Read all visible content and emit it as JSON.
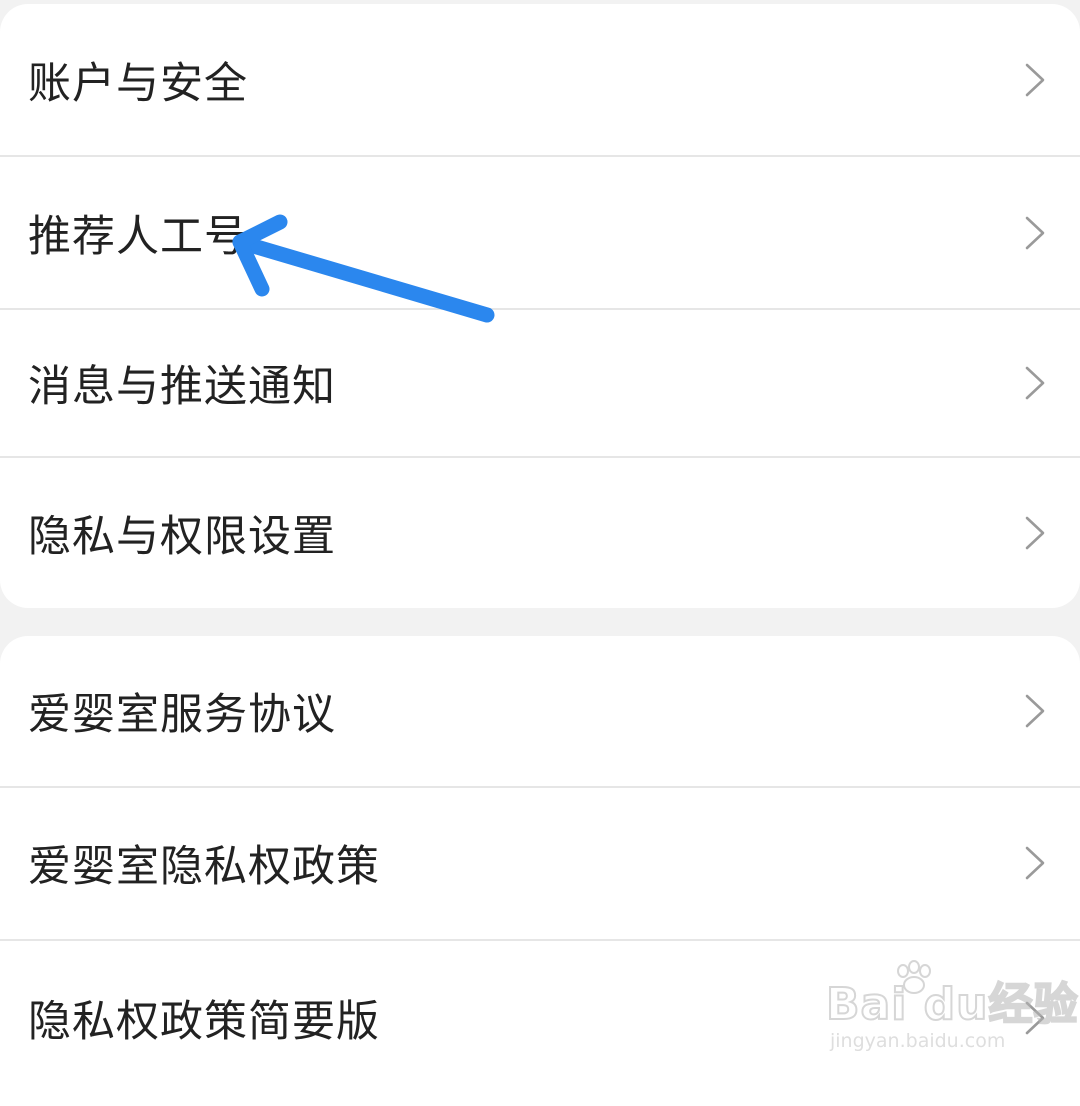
{
  "group1": {
    "items": [
      {
        "label": "账户与安全"
      },
      {
        "label": "推荐人工号"
      },
      {
        "label": "消息与推送通知"
      },
      {
        "label": "隐私与权限设置"
      }
    ]
  },
  "group2": {
    "items": [
      {
        "label": "爱婴室服务协议"
      },
      {
        "label": "爱婴室隐私权政策"
      },
      {
        "label": "隐私权政策简要版"
      }
    ]
  },
  "icons": {
    "row_chevron": "chevron-right-icon",
    "annotation": "arrow-annotation",
    "watermark_paw": "paw-icon"
  },
  "colors": {
    "annotation_arrow": "#2b87ee",
    "chevron": "#9a9a9a",
    "text": "#222222",
    "background": "#f2f2f2",
    "card": "#ffffff"
  },
  "watermark": {
    "brand": "Bai  du经验",
    "url": "jingyan.baidu.com"
  }
}
